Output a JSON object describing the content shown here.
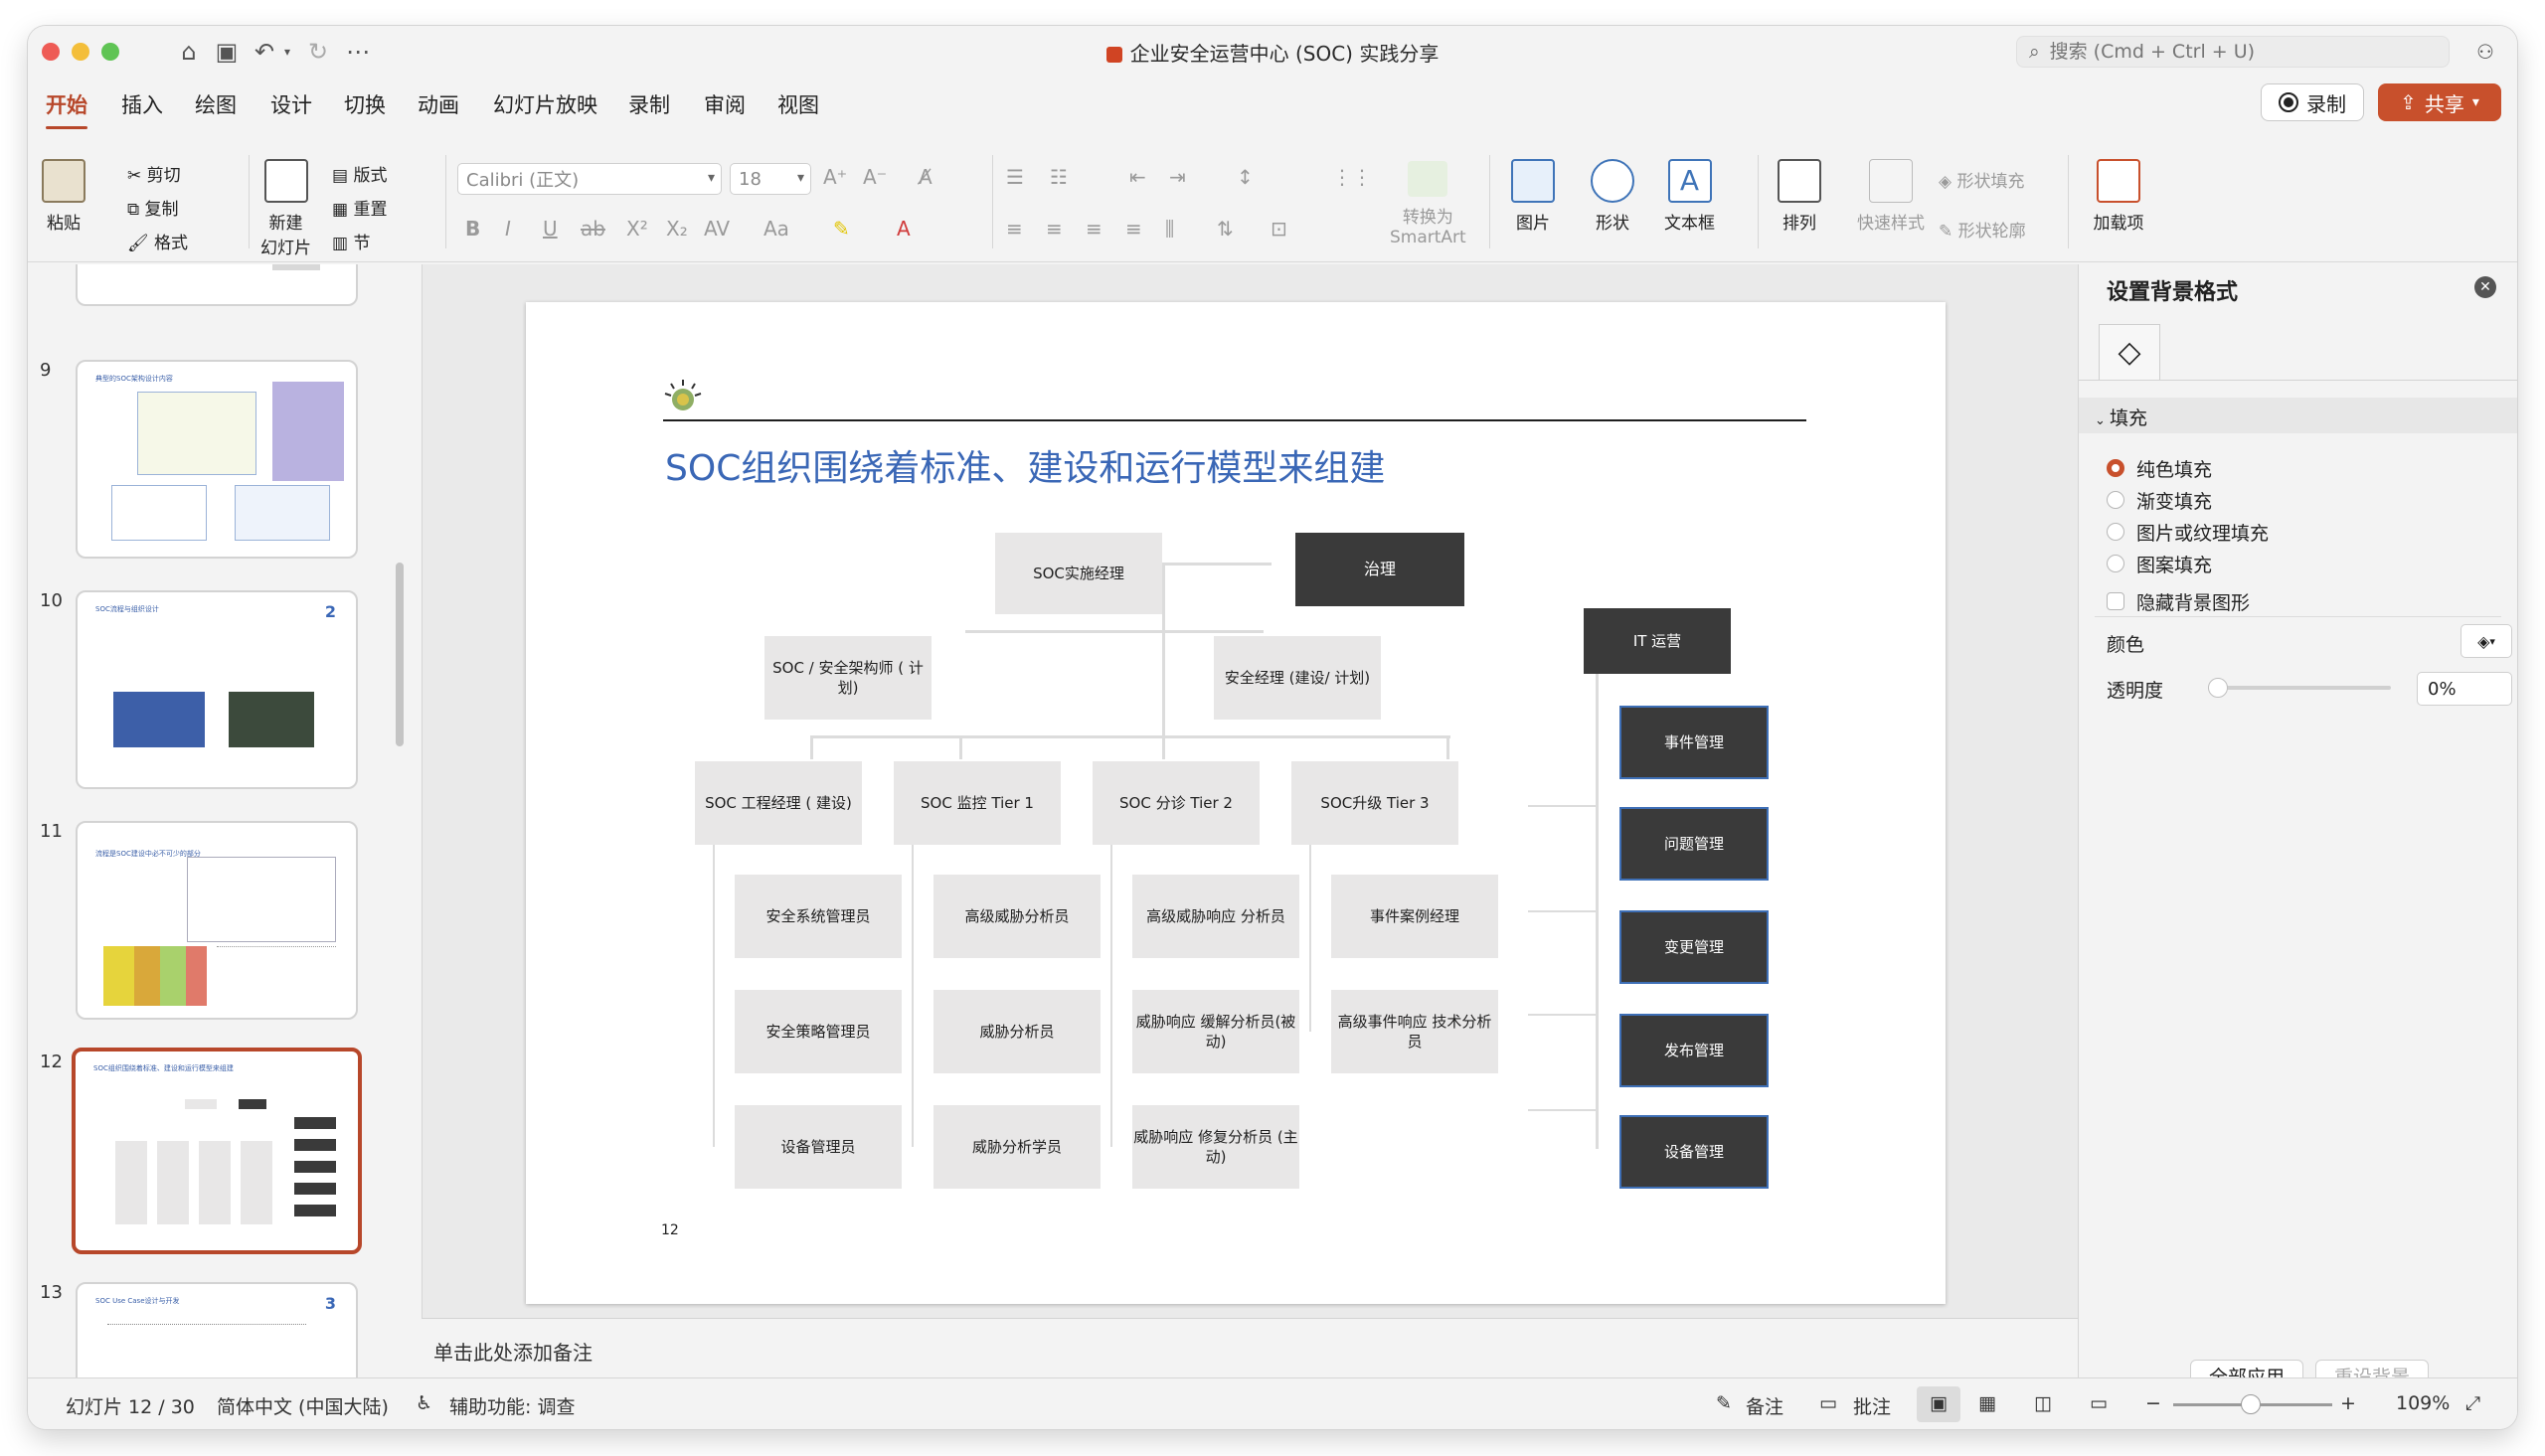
{
  "window": {
    "title": "企业安全运营中心 (SOC) 实践分享",
    "search_placeholder": "搜索 (Cmd + Ctrl + U)"
  },
  "tabs": [
    "开始",
    "插入",
    "绘图",
    "设计",
    "切换",
    "动画",
    "幻灯片放映",
    "录制",
    "审阅",
    "视图"
  ],
  "buttons": {
    "record": "录制",
    "share": "共享"
  },
  "ribbon": {
    "paste": "粘贴",
    "cut": "剪切",
    "copy": "复制",
    "format": "格式",
    "new_slide_1": "新建",
    "new_slide_2": "幻灯片",
    "layout": "版式",
    "reset": "重置",
    "section": "节",
    "font_name": "Calibri (正文)",
    "font_size": "18",
    "bold": "B",
    "italic": "I",
    "underline": "U",
    "strike": "ab",
    "superscript": "X²",
    "subscript": "X₂",
    "spacing": "AV",
    "case": "Aa",
    "smartart_1": "转换为",
    "smartart_2": "SmartArt",
    "picture": "图片",
    "shape": "形状",
    "textbox": "文本框",
    "arrange": "排列",
    "quick_style": "快速样式",
    "shape_fill": "形状填充",
    "shape_outline": "形状轮廓",
    "addins": "加载项"
  },
  "slide_panel": {
    "numbers": [
      "9",
      "10",
      "11",
      "12",
      "13"
    ],
    "t9_title": "典型的SOC架构设计内容",
    "t10_title": "SOC流程与组织设计",
    "t10_num": "2",
    "t11_title": "流程是SOC建设中必不可少的部分",
    "t12_title": "SOC组织围绕着标准、建设和运行模型来组建",
    "t13_title": "SOC Use Case设计与开发",
    "t13_num": "3"
  },
  "slide": {
    "title": "SOC组织围绕着标准、建设和运行模型来组建",
    "page_number": "12",
    "boxes": {
      "manager": "SOC实施经理",
      "governance": "治理",
      "architect": "SOC / 安全架构师 ( 计划)",
      "sec_manager": "安全经理 (建设/ 计划)",
      "it_ops": "IT 运营",
      "engineering": "SOC 工程经理 ( 建设)",
      "monitor": "SOC 监控 Tier 1",
      "triage": "SOC 分诊 Tier 2",
      "escalate": "SOC升级 Tier 3",
      "sys_admin": "安全系统管理员",
      "policy_admin": "安全策略管理员",
      "device_admin": "设备管理员",
      "senior_analyst": "高级威胁分析员",
      "analyst": "威胁分析员",
      "analyst_trainee": "威胁分析学员",
      "senior_response": "高级威胁响应 分析员",
      "mitigation": "威胁响应 缓解分析员(被动)",
      "repair": "威胁响应 修复分析员 (主动)",
      "case_manager": "事件案例经理",
      "senior_incident": "高级事件响应 技术分析员",
      "incident_mgmt": "事件管理",
      "problem_mgmt": "问题管理",
      "change_mgmt": "变更管理",
      "release_mgmt": "发布管理",
      "device_mgmt": "设备管理"
    }
  },
  "notes_placeholder": "单击此处添加备注",
  "format_pane": {
    "title": "设置背景格式",
    "section_fill": "填充",
    "options": [
      "纯色填充",
      "渐变填充",
      "图片或纹理填充",
      "图案填充"
    ],
    "hide_bg": "隐藏背景图形",
    "color_label": "颜色",
    "transparency_label": "透明度",
    "transparency_value": "0%",
    "apply_all": "全部应用",
    "reset_bg": "重设背景"
  },
  "statusbar": {
    "slide_count": "幻灯片 12 / 30",
    "language": "简体中文 (中国大陆)",
    "accessibility": "辅助功能: 调查",
    "notes": "备注",
    "comments": "批注",
    "zoom": "109%"
  },
  "colors": {
    "accent": "#b7472a",
    "share": "#c8502c",
    "title_blue": "#3a67b6",
    "dark_box": "#3a3a3a"
  }
}
